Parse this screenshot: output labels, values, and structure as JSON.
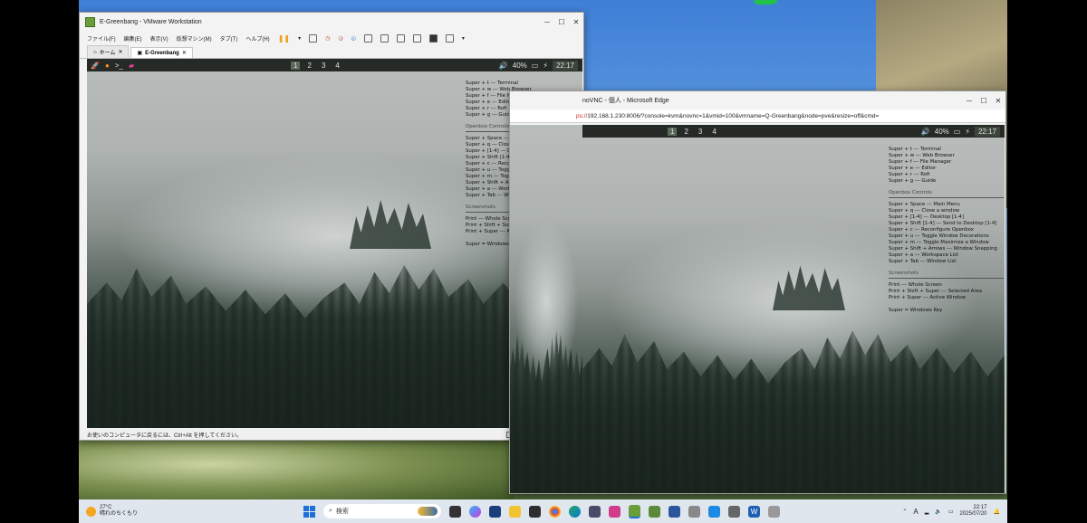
{
  "vmware": {
    "title": "E-Greenbang - VMware Workstation",
    "menu": [
      "ファイル(F)",
      "編集(E)",
      "表示(V)",
      "仮想マシン(M)",
      "タブ(T)",
      "ヘルプ(H)"
    ],
    "tabs": [
      {
        "label": "ホーム"
      },
      {
        "label": "E-Greenbang"
      }
    ],
    "status_text": "お使いのコンピュータに戻るには、Ctrl+Alt を押してください。"
  },
  "guest": {
    "desktops": [
      "1",
      "2",
      "3",
      "4"
    ],
    "battery": "40%",
    "clock": "22:17",
    "keybinds": [
      "Super + t --- Terminal",
      "Super + w --- Web Browser",
      "Super + f --- File Manager",
      "Super + e --- Editor",
      "Super + r --- Rofi",
      "Super + g --- Guide"
    ],
    "openbox_title": "Openbox Controls",
    "openbox": [
      "Super + Space --- Main Menu",
      "Super + q --- Close a window",
      "Super + [1-4] --- Desktop [1-4]",
      "Super + Shift [1-4] --- Send to Desktop [1-4]",
      "Super + c --- Reconfigure Openbox",
      "Super + u --- Toggle Window Decorations",
      "Super + m --- Toggle Maximize a Window",
      "Super + Shift + Arrows --- Window Snapping",
      "Super + a --- Workspace List",
      "Super + Tab --- Window List"
    ],
    "screenshots_title": "Screenshots",
    "screenshots": [
      "Print --- Whole Screen",
      "Print + Shift + Super --- Selected Area",
      "Print + Super --- Active Window"
    ],
    "super_note": "Super = Windows Key"
  },
  "edge": {
    "title": "noVNC - 個人 - Microsoft Edge",
    "url_scheme": "ps://",
    "url_rest": "192.168.1.230:8006/?console=kvm&novnc=1&vmid=100&vmname=Q-Greenbang&node=pve&resize=off&cmd="
  },
  "taskbar": {
    "temp": "27°C",
    "weather": "晴れのちくもり",
    "search_placeholder": "検索",
    "time": "22:17",
    "date": "2025/07/20",
    "ime": "A"
  },
  "colors": {
    "accent": "#1e6fd9",
    "guest_bar": "#262a26",
    "pause": "#f0a020"
  }
}
